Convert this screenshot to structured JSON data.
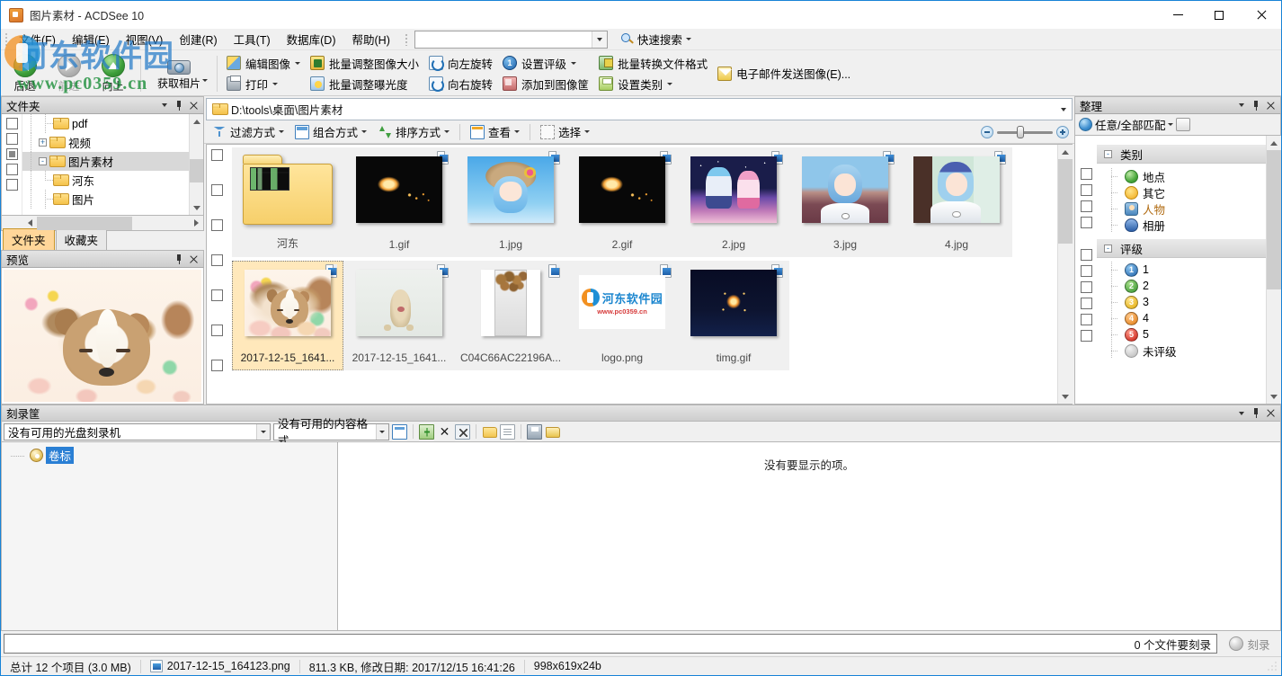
{
  "window": {
    "title": "图片素材 - ACDSee 10",
    "minimize_label": "Minimize",
    "maximize_label": "Maximize",
    "close_label": "Close"
  },
  "menubar": {
    "items": [
      {
        "label": "文件(F)"
      },
      {
        "label": "编辑(E)"
      },
      {
        "label": "视图(V)"
      },
      {
        "label": "创建(R)"
      },
      {
        "label": "工具(T)"
      },
      {
        "label": "数据库(D)"
      },
      {
        "label": "帮助(H)"
      }
    ],
    "search_value": "",
    "search_placeholder": "",
    "quick_search_label": "快速搜索"
  },
  "toolbar": {
    "back": "后退",
    "forward": "前进",
    "up": "向上",
    "get_photos": "获取相片",
    "edit_image": "编辑图像",
    "print": "打印",
    "batch_resize": "批量调整图像大小",
    "batch_exposure": "批量调整曝光度",
    "rotate_left": "向左旋转",
    "rotate_right": "向右旋转",
    "set_rating": "设置评级",
    "rating_number": "1",
    "add_to_basket": "添加到图像筐",
    "batch_convert": "批量转换文件格式",
    "set_category": "设置类别",
    "email_images": "电子邮件发送图像(E)..."
  },
  "folders_panel": {
    "title": "文件夹",
    "tree": [
      {
        "label": "pdf",
        "indent": 2,
        "expander": "",
        "selected": false
      },
      {
        "label": "视频",
        "indent": 1,
        "expander": "+",
        "selected": false
      },
      {
        "label": "图片素材",
        "indent": 1,
        "expander": "-",
        "selected": true
      },
      {
        "label": "河东",
        "indent": 2,
        "expander": "",
        "selected": false
      },
      {
        "label": "图片",
        "indent": 1,
        "expander": "",
        "selected": false
      }
    ],
    "tabs": [
      {
        "label": "文件夹",
        "active": true
      },
      {
        "label": "收藏夹",
        "active": false
      }
    ]
  },
  "preview_panel": {
    "title": "预览"
  },
  "address_bar": {
    "path": "D:\\tools\\桌面\\图片素材"
  },
  "view_controls": {
    "filter": "过滤方式",
    "group": "组合方式",
    "sort": "排序方式",
    "view": "查看",
    "select": "选择"
  },
  "thumbnails": [
    {
      "name": "河东",
      "kind": "folder",
      "selected": false,
      "badge": false
    },
    {
      "name": "1.gif",
      "kind": "fire",
      "selected": false,
      "badge": true
    },
    {
      "name": "1.jpg",
      "kind": "rem1",
      "selected": false,
      "badge": true
    },
    {
      "name": "2.gif",
      "kind": "fire",
      "selected": false,
      "badge": true
    },
    {
      "name": "2.jpg",
      "kind": "rem2",
      "selected": false,
      "badge": true
    },
    {
      "name": "3.jpg",
      "kind": "rem3",
      "selected": false,
      "badge": true
    },
    {
      "name": "4.jpg",
      "kind": "rem4",
      "selected": false,
      "badge": true
    },
    {
      "name": "2017-12-15_1641...",
      "kind": "puppy",
      "selected": true,
      "badge": true
    },
    {
      "name": "2017-12-15_1641...",
      "kind": "puppy2",
      "selected": false,
      "badge": true
    },
    {
      "name": "C04C66AC22196A...",
      "kind": "nuts",
      "selected": false,
      "badge": true
    },
    {
      "name": "logo.png",
      "kind": "logo",
      "selected": false,
      "badge": true
    },
    {
      "name": "timg.gif",
      "kind": "firework",
      "selected": false,
      "badge": true
    }
  ],
  "organize_panel": {
    "title": "整理",
    "match_label": "任意/全部匹配",
    "groups": [
      {
        "title": "类别",
        "items": [
          {
            "label": "地点",
            "icon": "place-icon",
            "highlight": false
          },
          {
            "label": "其它",
            "icon": "other-icon",
            "highlight": false
          },
          {
            "label": "人物",
            "icon": "people-icon",
            "highlight": true
          },
          {
            "label": "相册",
            "icon": "album-icon",
            "highlight": false
          }
        ]
      },
      {
        "title": "评级",
        "items": [
          {
            "label": "1",
            "icon": "rating-1-icon",
            "highlight": false
          },
          {
            "label": "2",
            "icon": "rating-2-icon",
            "highlight": false
          },
          {
            "label": "3",
            "icon": "rating-3-icon",
            "highlight": false
          },
          {
            "label": "4",
            "icon": "rating-4-icon",
            "highlight": false
          },
          {
            "label": "5",
            "icon": "rating-5-icon",
            "highlight": false
          },
          {
            "label": "未评级",
            "icon": "rating-none-icon",
            "highlight": false
          }
        ]
      }
    ]
  },
  "basket": {
    "title": "刻录筐",
    "device_value": "没有可用的光盘刻录机",
    "format_value": "没有可用的内容格式",
    "volume_label": "卷标",
    "empty_message": "没有要显示的项。",
    "files_to_burn": "0 个文件要刻录",
    "burn_button": "刻录"
  },
  "statusbar": {
    "total": "总计 12 个项目 (3.0 MB)",
    "filename": "2017-12-15_164123.png",
    "filesize": "811.3 KB, 修改日期: 2017/12/15 16:41:26",
    "dimensions": "998x619x24b"
  },
  "watermark": {
    "cn": "河东软件园",
    "url": "www.pc0359.cn"
  }
}
